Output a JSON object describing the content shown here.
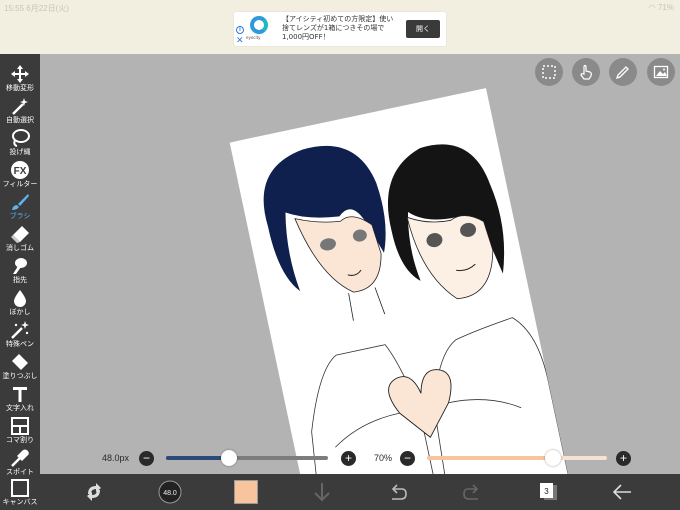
{
  "status_bar": {
    "time": "15:55  6月22日(火)",
    "battery": "71%"
  },
  "ad": {
    "brand": "eyecity",
    "text": "【アイシティ初めての方限定】使い捨てレンズが1箱につきその場で1,000円OFF！",
    "open_button": "開く",
    "info_icon": "i",
    "close_icon": "✕"
  },
  "tools": [
    {
      "name": "move-transform",
      "label": "移動変形",
      "icon": "move-icon"
    },
    {
      "name": "auto-select",
      "label": "自動選択",
      "icon": "magic-wand-icon"
    },
    {
      "name": "lasso",
      "label": "投げ縄",
      "icon": "lasso-icon"
    },
    {
      "name": "filter",
      "label": "フィルター",
      "icon": "fx-icon"
    },
    {
      "name": "brush",
      "label": "ブラシ",
      "icon": "brush-icon",
      "active": true
    },
    {
      "name": "eraser",
      "label": "消しゴム",
      "icon": "eraser-icon"
    },
    {
      "name": "finger",
      "label": "指先",
      "icon": "finger-icon"
    },
    {
      "name": "blur",
      "label": "ぼかし",
      "icon": "droplet-icon"
    },
    {
      "name": "special-pen",
      "label": "特殊ペン",
      "icon": "special-pen-icon"
    },
    {
      "name": "fill",
      "label": "塗りつぶし",
      "icon": "bucket-icon"
    },
    {
      "name": "text",
      "label": "文字入れ",
      "icon": "text-icon"
    },
    {
      "name": "frame-divider",
      "label": "コマ割り",
      "icon": "frame-icon"
    },
    {
      "name": "eyedropper",
      "label": "スポイト",
      "icon": "eyedropper-icon"
    },
    {
      "name": "canvas",
      "label": "キャンバス",
      "icon": "canvas-icon"
    }
  ],
  "brush_size": {
    "label": "48.0px",
    "minus": "−",
    "plus": "+",
    "level": 0.39
  },
  "opacity": {
    "label": "70%",
    "minus": "−",
    "plus": "+",
    "level": 0.7
  },
  "bottom_bar": {
    "brush_size_badge": "48.0",
    "layer_count": "3",
    "current_color": "#f7c49d"
  },
  "colors": {
    "panel": "#3b3b3b",
    "canvas_bg": "#b3b3b3",
    "accent": "#5fb3ea",
    "size_track": "#2b4a78",
    "opacity_track": "#f7c49d"
  }
}
